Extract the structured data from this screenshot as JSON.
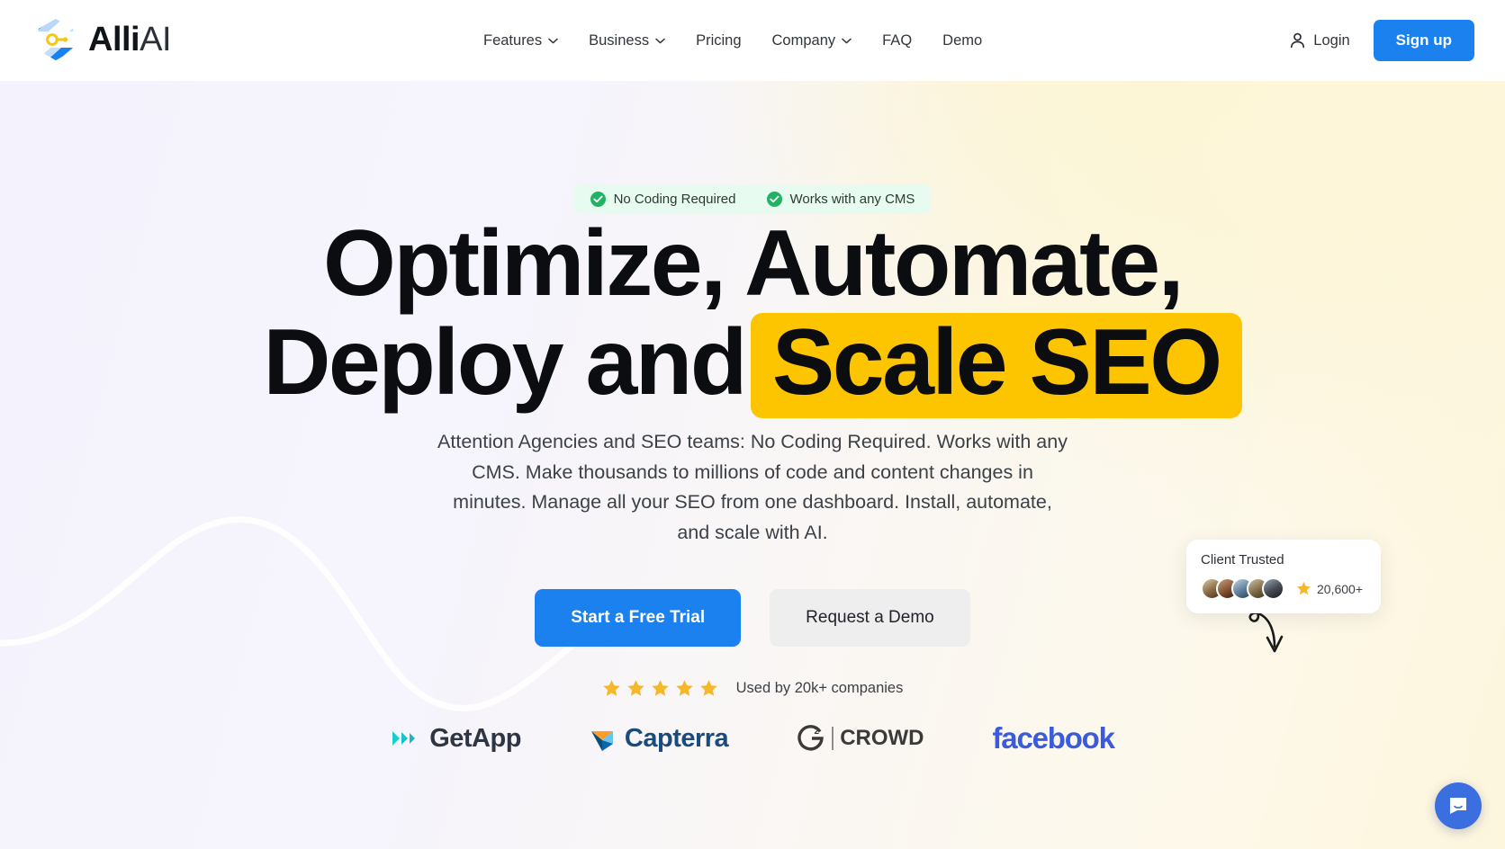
{
  "brand": {
    "name_bold": "Alli",
    "name_light": "AI",
    "logo_icon": "alli-hexagon-logo",
    "accent_blue": "#1b81ef",
    "accent_yellow": "#fcc500",
    "accent_green": "#22b263"
  },
  "nav": {
    "items": [
      {
        "label": "Features",
        "has_dropdown": true,
        "icon": "chevron-down-icon"
      },
      {
        "label": "Business",
        "has_dropdown": true,
        "icon": "chevron-down-icon"
      },
      {
        "label": "Pricing",
        "has_dropdown": false,
        "icon": ""
      },
      {
        "label": "Company",
        "has_dropdown": true,
        "icon": "chevron-down-icon"
      },
      {
        "label": "FAQ",
        "has_dropdown": false,
        "icon": ""
      },
      {
        "label": "Demo",
        "has_dropdown": false,
        "icon": ""
      }
    ],
    "login_label": "Login",
    "login_icon": "user-icon",
    "signup_label": "Sign up"
  },
  "hero": {
    "badges": [
      {
        "label": "No Coding Required",
        "icon": "check-circle-icon"
      },
      {
        "label": "Works with any CMS",
        "icon": "check-circle-icon"
      }
    ],
    "headline_line1": "Optimize, Automate,",
    "headline_line2_prefix": "Deploy and",
    "headline_highlight": "Scale SEO",
    "subtext": "Attention Agencies and SEO teams: No Coding Required. Works with any CMS. Make thousands to millions of code and content changes in minutes. Manage all your SEO from one dashboard. Install, automate, and scale with AI.",
    "cta_primary": "Start a Free Trial",
    "cta_secondary": "Request a Demo",
    "rating_stars": 5,
    "rating_star_icon": "star-icon",
    "rating_label": "Used by 20k+ companies"
  },
  "trust_card": {
    "title": "Client Trusted",
    "count": "20,600+",
    "star_icon": "star-icon",
    "avatar_count": 5,
    "avatar_icon": "avatar"
  },
  "partner_logos": [
    {
      "name": "GetApp",
      "label": "GetApp",
      "icon": "getapp-chevrons-icon",
      "color": "#2f3542"
    },
    {
      "name": "Capterra",
      "label": "Capterra",
      "icon": "capterra-triangle-icon",
      "color": "#1b4b7d"
    },
    {
      "name": "G2 Crowd",
      "label": "CROWD",
      "icon": "g2-icon",
      "color": "#3a3a3a"
    },
    {
      "name": "Facebook",
      "label": "facebook",
      "icon": "facebook-wordmark-icon",
      "color": "#3b5bdb"
    }
  ],
  "chat": {
    "icon": "chat-bubble-icon",
    "color": "#3b6fe0"
  }
}
